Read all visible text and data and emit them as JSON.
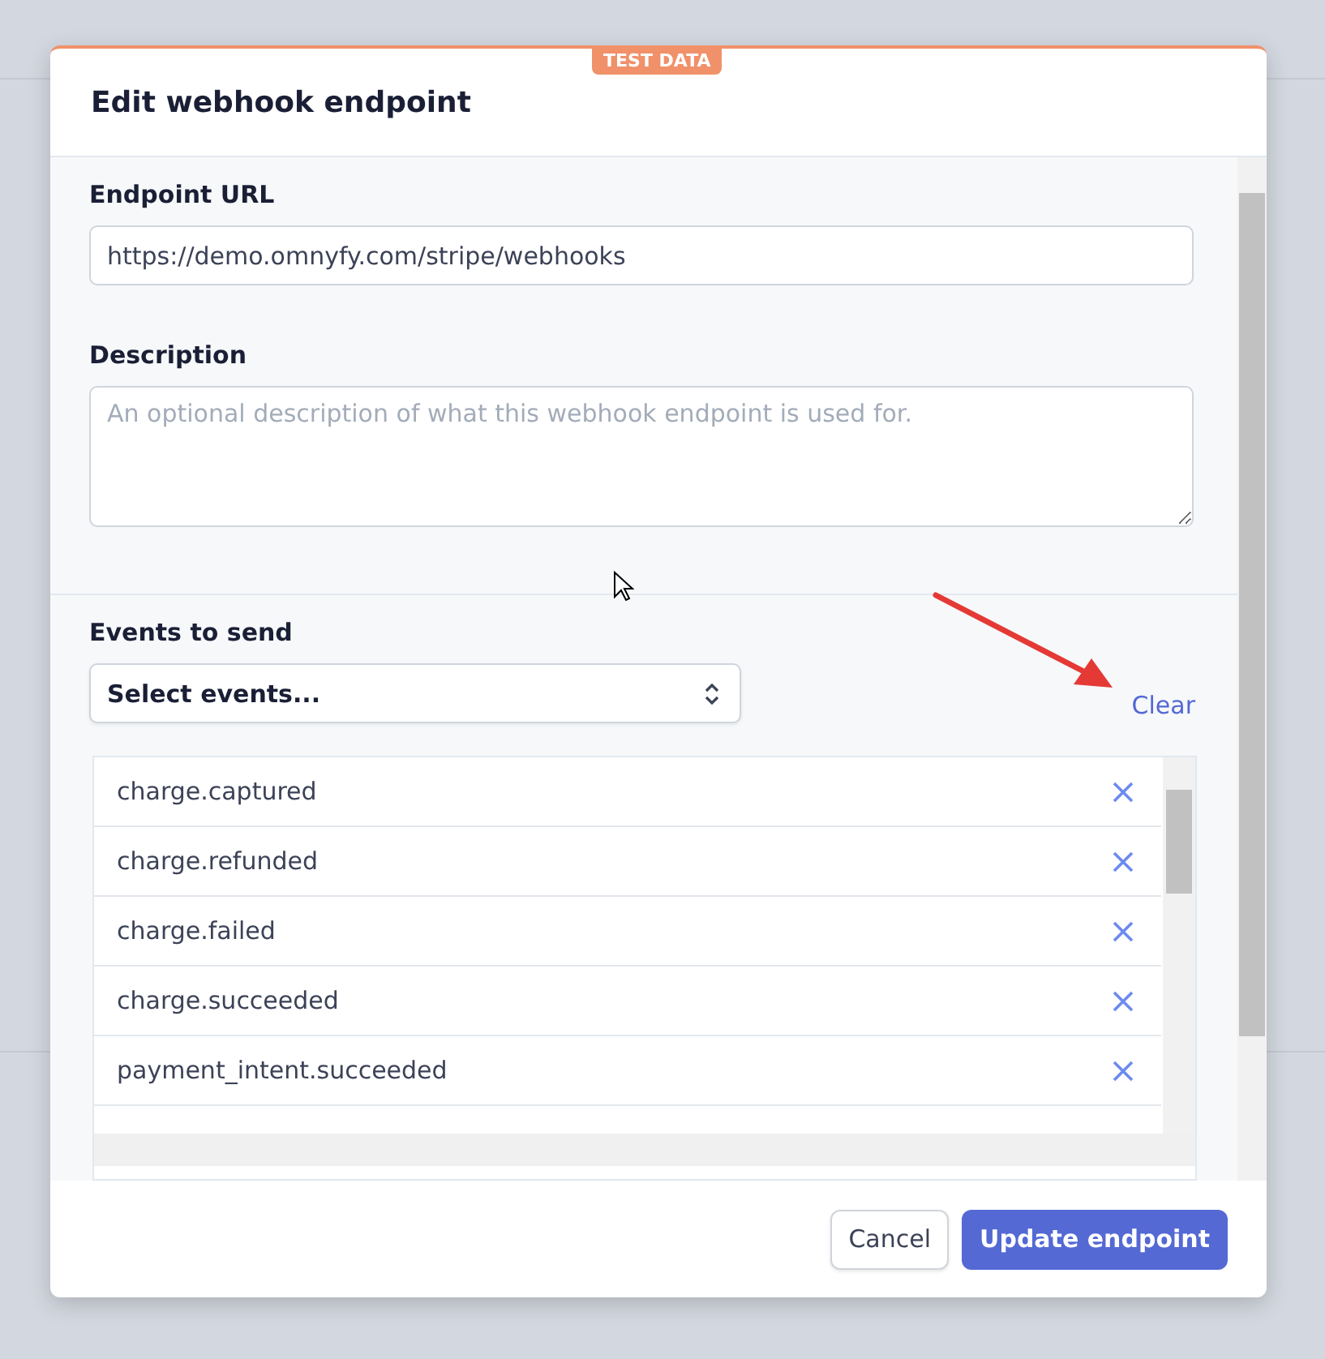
{
  "badge": "TEST DATA",
  "title": "Edit webhook endpoint",
  "fields": [
    {
      "label": "Endpoint URL",
      "kind": "input",
      "value": "https://demo.omnyfy.com/stripe/webhooks"
    },
    {
      "label": "Description",
      "kind": "textarea",
      "placeholder": "An optional description of what this webhook endpoint is used for."
    }
  ],
  "events": {
    "label": "Events to send",
    "select": "Select events...",
    "clear": "Clear",
    "items": [
      "charge.captured",
      "charge.refunded",
      "charge.failed",
      "charge.succeeded",
      "payment_intent.succeeded"
    ]
  },
  "buttons": [
    {
      "label": "Cancel",
      "kind": "secondary"
    },
    {
      "label": "Update endpoint",
      "kind": "primary"
    }
  ]
}
